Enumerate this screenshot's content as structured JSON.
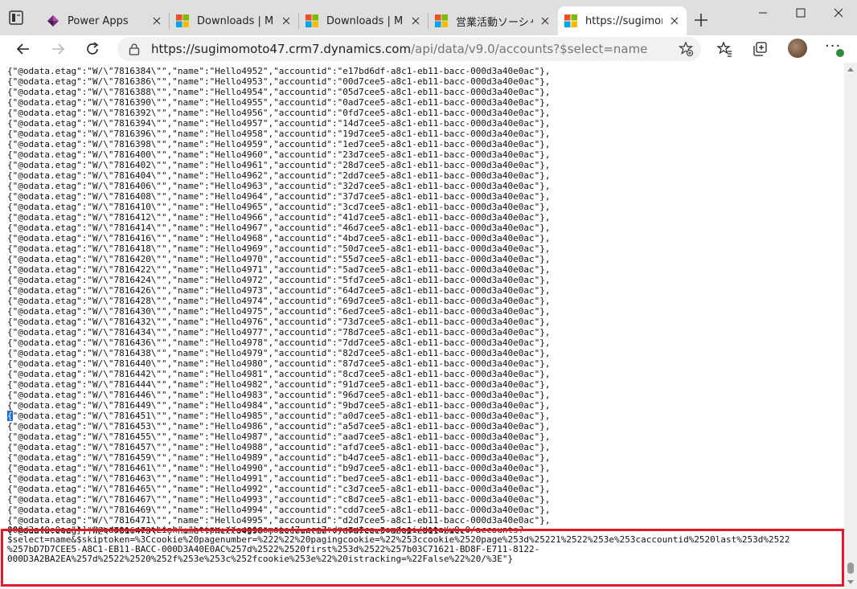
{
  "tabs": [
    {
      "title": "Power Apps",
      "icon": "power-apps-icon"
    },
    {
      "title": "Downloads | Micro",
      "icon": "microsoft-logo-icon"
    },
    {
      "title": "Downloads | Micro",
      "icon": "microsoft-logo-icon"
    },
    {
      "title": "営業活動ソーシャル",
      "icon": "microsoft-logo-icon"
    },
    {
      "title": "https://sugimomo",
      "icon": "microsoft-logo-icon",
      "active": true
    }
  ],
  "address": {
    "host": "https://sugimomoto47.crm7.dynamics.com",
    "path": "/api/data/v9.0/accounts?$select=name"
  },
  "rows": [
    {
      "etag": "7816384",
      "name": "Hello4952",
      "accountid": "e17bd6df-a8c1-eb11-bacc-000d3a40e0ac"
    },
    {
      "etag": "7816386",
      "name": "Hello4953",
      "accountid": "00d7cee5-a8c1-eb11-bacc-000d3a40e0ac"
    },
    {
      "etag": "7816388",
      "name": "Hello4954",
      "accountid": "05d7cee5-a8c1-eb11-bacc-000d3a40e0ac"
    },
    {
      "etag": "7816390",
      "name": "Hello4955",
      "accountid": "0ad7cee5-a8c1-eb11-bacc-000d3a40e0ac"
    },
    {
      "etag": "7816392",
      "name": "Hello4956",
      "accountid": "0fd7cee5-a8c1-eb11-bacc-000d3a40e0ac"
    },
    {
      "etag": "7816394",
      "name": "Hello4957",
      "accountid": "14d7cee5-a8c1-eb11-bacc-000d3a40e0ac"
    },
    {
      "etag": "7816396",
      "name": "Hello4958",
      "accountid": "19d7cee5-a8c1-eb11-bacc-000d3a40e0ac"
    },
    {
      "etag": "7816398",
      "name": "Hello4959",
      "accountid": "1ed7cee5-a8c1-eb11-bacc-000d3a40e0ac"
    },
    {
      "etag": "7816400",
      "name": "Hello4960",
      "accountid": "23d7cee5-a8c1-eb11-bacc-000d3a40e0ac"
    },
    {
      "etag": "7816402",
      "name": "Hello4961",
      "accountid": "28d7cee5-a8c1-eb11-bacc-000d3a40e0ac"
    },
    {
      "etag": "7816404",
      "name": "Hello4962",
      "accountid": "2dd7cee5-a8c1-eb11-bacc-000d3a40e0ac"
    },
    {
      "etag": "7816406",
      "name": "Hello4963",
      "accountid": "32d7cee5-a8c1-eb11-bacc-000d3a40e0ac"
    },
    {
      "etag": "7816408",
      "name": "Hello4964",
      "accountid": "37d7cee5-a8c1-eb11-bacc-000d3a40e0ac"
    },
    {
      "etag": "7816410",
      "name": "Hello4965",
      "accountid": "3cd7cee5-a8c1-eb11-bacc-000d3a40e0ac"
    },
    {
      "etag": "7816412",
      "name": "Hello4966",
      "accountid": "41d7cee5-a8c1-eb11-bacc-000d3a40e0ac"
    },
    {
      "etag": "7816414",
      "name": "Hello4967",
      "accountid": "46d7cee5-a8c1-eb11-bacc-000d3a40e0ac"
    },
    {
      "etag": "7816416",
      "name": "Hello4968",
      "accountid": "4bd7cee5-a8c1-eb11-bacc-000d3a40e0ac"
    },
    {
      "etag": "7816418",
      "name": "Hello4969",
      "accountid": "50d7cee5-a8c1-eb11-bacc-000d3a40e0ac"
    },
    {
      "etag": "7816420",
      "name": "Hello4970",
      "accountid": "55d7cee5-a8c1-eb11-bacc-000d3a40e0ac"
    },
    {
      "etag": "7816422",
      "name": "Hello4971",
      "accountid": "5ad7cee5-a8c1-eb11-bacc-000d3a40e0ac"
    },
    {
      "etag": "7816424",
      "name": "Hello4972",
      "accountid": "5fd7cee5-a8c1-eb11-bacc-000d3a40e0ac"
    },
    {
      "etag": "7816426",
      "name": "Hello4973",
      "accountid": "64d7cee5-a8c1-eb11-bacc-000d3a40e0ac"
    },
    {
      "etag": "7816428",
      "name": "Hello4974",
      "accountid": "69d7cee5-a8c1-eb11-bacc-000d3a40e0ac"
    },
    {
      "etag": "7816430",
      "name": "Hello4975",
      "accountid": "6ed7cee5-a8c1-eb11-bacc-000d3a40e0ac"
    },
    {
      "etag": "7816432",
      "name": "Hello4976",
      "accountid": "73d7cee5-a8c1-eb11-bacc-000d3a40e0ac"
    },
    {
      "etag": "7816434",
      "name": "Hello4977",
      "accountid": "78d7cee5-a8c1-eb11-bacc-000d3a40e0ac"
    },
    {
      "etag": "7816436",
      "name": "Hello4978",
      "accountid": "7dd7cee5-a8c1-eb11-bacc-000d3a40e0ac"
    },
    {
      "etag": "7816438",
      "name": "Hello4979",
      "accountid": "82d7cee5-a8c1-eb11-bacc-000d3a40e0ac"
    },
    {
      "etag": "7816440",
      "name": "Hello4980",
      "accountid": "87d7cee5-a8c1-eb11-bacc-000d3a40e0ac"
    },
    {
      "etag": "7816442",
      "name": "Hello4981",
      "accountid": "8cd7cee5-a8c1-eb11-bacc-000d3a40e0ac"
    },
    {
      "etag": "7816444",
      "name": "Hello4982",
      "accountid": "91d7cee5-a8c1-eb11-bacc-000d3a40e0ac"
    },
    {
      "etag": "7816446",
      "name": "Hello4983",
      "accountid": "96d7cee5-a8c1-eb11-bacc-000d3a40e0ac"
    },
    {
      "etag": "7816449",
      "name": "Hello4984",
      "accountid": "9bd7cee5-a8c1-eb11-bacc-000d3a40e0ac"
    },
    {
      "etag": "7816451",
      "name": "Hello4985",
      "accountid": "a0d7cee5-a8c1-eb11-bacc-000d3a40e0ac"
    },
    {
      "etag": "7816453",
      "name": "Hello4986",
      "accountid": "a5d7cee5-a8c1-eb11-bacc-000d3a40e0ac"
    },
    {
      "etag": "7816455",
      "name": "Hello4987",
      "accountid": "aad7cee5-a8c1-eb11-bacc-000d3a40e0ac"
    },
    {
      "etag": "7816457",
      "name": "Hello4988",
      "accountid": "afd7cee5-a8c1-eb11-bacc-000d3a40e0ac"
    },
    {
      "etag": "7816459",
      "name": "Hello4989",
      "accountid": "b4d7cee5-a8c1-eb11-bacc-000d3a40e0ac"
    },
    {
      "etag": "7816461",
      "name": "Hello4990",
      "accountid": "b9d7cee5-a8c1-eb11-bacc-000d3a40e0ac"
    },
    {
      "etag": "7816463",
      "name": "Hello4991",
      "accountid": "bed7cee5-a8c1-eb11-bacc-000d3a40e0ac"
    },
    {
      "etag": "7816465",
      "name": "Hello4992",
      "accountid": "c3d7cee5-a8c1-eb11-bacc-000d3a40e0ac"
    },
    {
      "etag": "7816467",
      "name": "Hello4993",
      "accountid": "c8d7cee5-a8c1-eb11-bacc-000d3a40e0ac"
    },
    {
      "etag": "7816469",
      "name": "Hello4994",
      "accountid": "cdd7cee5-a8c1-eb11-bacc-000d3a40e0ac"
    },
    {
      "etag": "7816471",
      "name": "Hello4995",
      "accountid": "d2d7cee5-a8c1-eb11-bacc-000d3a40e0ac"
    },
    {
      "etag": "7816473",
      "name": "Hello4996",
      "accountid": "d7d7cee5-a8c1-eb11-bacc-"
    }
  ],
  "next_link": {
    "line1": "000d3a40e0ac\"}],\"@odata.nextLink\":\"https://sugimomoto47.crm7.dynamics.com/api/data/v9.0/accounts?",
    "line2": "$select=name&$skiptoken=%3Ccookie%20pagenumber=%222%22%20pagingcookie=%22%253ccookie%2520page%253d%25221%2522%253e%253caccountid%2520last%253d%2522",
    "line3": "%257bD7D7CEE5-A8C1-EB11-BACC-000D3A40E0AC%257d%2522%2520first%253d%2522%257b03C71621-BD8F-E711-8122-",
    "line4": "000D3A2BA2EA%257d%2522%2520%252f%253e%253c%252fcookie%253e%22%20istracking=%22False%22%20/%3E\"}"
  },
  "colors": {
    "highlight_border": "#e11c2a",
    "tab_strip": "#dfdfdf",
    "avatar_badge": "#2e8b3a"
  }
}
